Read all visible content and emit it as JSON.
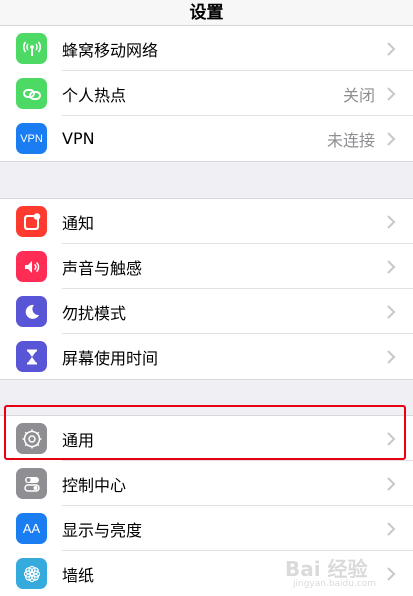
{
  "header": {
    "title": "设置"
  },
  "group1": [
    {
      "label": "蜂窝移动网络",
      "value": "",
      "icon": "cellular-antenna-icon",
      "color": "#4cd964"
    },
    {
      "label": "个人热点",
      "value": "关闭",
      "icon": "hotspot-chain-icon",
      "color": "#4cd964"
    },
    {
      "label": "VPN",
      "value": "未连接",
      "icon": "vpn-icon",
      "icon_text": "VPN",
      "color": "#1a7ef2"
    }
  ],
  "group2": [
    {
      "label": "通知",
      "value": "",
      "icon": "notifications-icon",
      "color": "#ff3b30"
    },
    {
      "label": "声音与触感",
      "value": "",
      "icon": "speaker-icon",
      "color": "#ff2d55"
    },
    {
      "label": "勿扰模式",
      "value": "",
      "icon": "moon-icon",
      "color": "#5856d6"
    },
    {
      "label": "屏幕使用时间",
      "value": "",
      "icon": "hourglass-icon",
      "color": "#5856d6"
    }
  ],
  "group3": [
    {
      "label": "通用",
      "value": "",
      "icon": "gear-icon",
      "color": "#8e8e93"
    },
    {
      "label": "控制中心",
      "value": "",
      "icon": "toggles-icon",
      "color": "#8e8e93"
    },
    {
      "label": "显示与亮度",
      "value": "",
      "icon": "text-size-icon",
      "icon_text": "AA",
      "color": "#1a7ef2"
    },
    {
      "label": "墙纸",
      "value": "",
      "icon": "flower-icon",
      "color": "#35aadc"
    }
  ],
  "watermark": {
    "text": "Bai 经验",
    "sub": "jingyan.baidu.com"
  },
  "highlight_color": "#e60012"
}
